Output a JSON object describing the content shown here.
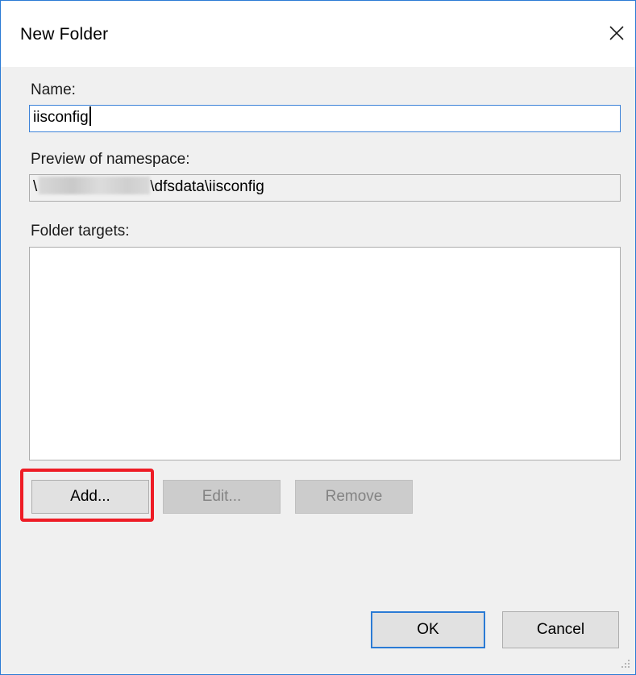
{
  "dialog": {
    "title": "New Folder",
    "close_icon": "close-icon"
  },
  "name": {
    "label": "Name:",
    "value": "iisconfig"
  },
  "preview": {
    "label": "Preview of namespace:",
    "prefix": "\\",
    "suffix": "\\dfsdata\\iisconfig"
  },
  "folder_targets": {
    "label": "Folder targets:",
    "items": []
  },
  "buttons": {
    "add": "Add...",
    "edit": "Edit...",
    "remove": "Remove",
    "ok": "OK",
    "cancel": "Cancel"
  },
  "colors": {
    "accent": "#2b7bd5",
    "highlight": "#ee1c25",
    "window_bg": "#f0f0f0"
  }
}
